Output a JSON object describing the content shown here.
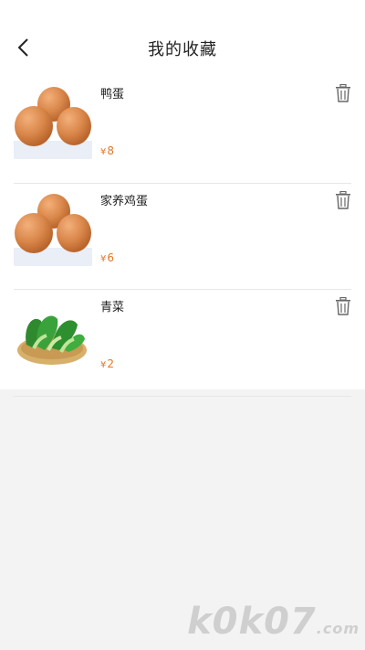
{
  "header": {
    "title": "我的收藏"
  },
  "items": [
    {
      "name": "鸭蛋",
      "price_symbol": "¥",
      "price": "8",
      "image": "eggs"
    },
    {
      "name": "家养鸡蛋",
      "price_symbol": "¥",
      "price": "6",
      "image": "eggs"
    },
    {
      "name": "青菜",
      "price_symbol": "¥",
      "price": "2",
      "image": "bok-choy"
    }
  ],
  "icons": {
    "back": "chevron-left-icon",
    "delete": "trash-icon"
  },
  "colors": {
    "price": "#e0782b",
    "background": "#f3f3f3"
  },
  "watermark": {
    "text": "k0k07",
    "suffix": ".com"
  }
}
